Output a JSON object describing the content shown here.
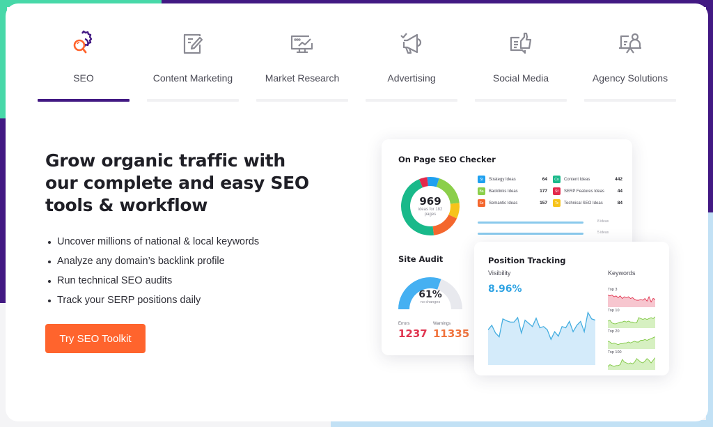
{
  "tabs": [
    {
      "label": "SEO",
      "icon": "seo-gear-magnifier-icon",
      "active": true
    },
    {
      "label": "Content Marketing",
      "icon": "document-edit-icon",
      "active": false
    },
    {
      "label": "Market Research",
      "icon": "monitor-chart-icon",
      "active": false
    },
    {
      "label": "Advertising",
      "icon": "megaphone-icon",
      "active": false
    },
    {
      "label": "Social Media",
      "icon": "thumbs-up-chat-icon",
      "active": false
    },
    {
      "label": "Agency Solutions",
      "icon": "presenter-board-icon",
      "active": false
    }
  ],
  "hero": {
    "headline": "Grow organic traffic with our complete and easy SEO tools & workflow",
    "bullets": [
      "Uncover millions of national & local keywords",
      "Analyze any domain’s backlink profile",
      "Run technical SEO audits",
      "Track your SERP positions daily"
    ],
    "cta_label": "Try SEO Toolkit"
  },
  "colors": {
    "brand_purple": "#421983",
    "cta_orange": "#ff642d",
    "accent_blue": "#2fa3e3",
    "errors_red": "#e0344f",
    "warnings_orange": "#f0733c"
  },
  "on_page_checker": {
    "title": "On Page SEO Checker",
    "total": "969",
    "total_sub": "ideas for 182 pages",
    "ideas": [
      {
        "abbr": "St",
        "label": "Strategy Ideas",
        "value": 64,
        "color": "#1ea0f0"
      },
      {
        "abbr": "Co",
        "label": "Content Ideas",
        "value": 442,
        "color": "#19b98a"
      },
      {
        "abbr": "Ba",
        "label": "Backlinks Ideas",
        "value": 177,
        "color": "#8bcf4a"
      },
      {
        "abbr": "Sf",
        "label": "SERP Features Ideas",
        "value": 44,
        "color": "#e3284b"
      },
      {
        "abbr": "Se",
        "label": "Semantic Ideas",
        "value": 157,
        "color": "#f4672e"
      },
      {
        "abbr": "Te",
        "label": "Technical SEO Ideas",
        "value": 84,
        "color": "#f7c31a"
      }
    ],
    "donut_order": [
      "SERP Features Ideas",
      "Strategy Ideas",
      "Backlinks Ideas",
      "Technical SEO Ideas",
      "Semantic Ideas",
      "Content Ideas"
    ],
    "bars": [
      {
        "label": "8 ideas"
      },
      {
        "label": "5 ideas"
      }
    ]
  },
  "site_audit": {
    "title": "Site Audit",
    "percent": 61,
    "percent_label": "61%",
    "sub": "no changes",
    "errors_label": "Errors",
    "errors_value": "1237",
    "warnings_label": "Warnings",
    "warnings_value": "11335"
  },
  "position_tracking": {
    "title": "Position Tracking",
    "visibility_label": "Visibility",
    "visibility_value": "8.96%",
    "visibility_series": [
      55,
      62,
      50,
      44,
      72,
      69,
      67,
      67,
      74,
      50,
      70,
      65,
      60,
      73,
      58,
      60,
      55,
      40,
      52,
      45,
      60,
      58,
      68,
      52,
      62,
      68,
      52,
      82,
      72,
      70
    ],
    "keywords_label": "Keywords",
    "keywords": [
      {
        "label": "Top 3",
        "color": "#e0344f",
        "fill": "#f7c6cf",
        "series": [
          14,
          13,
          14,
          12,
          13,
          11,
          13,
          10,
          12,
          11,
          12,
          10,
          11,
          9,
          8,
          8,
          9,
          8,
          10,
          7,
          12,
          6,
          10,
          9
        ]
      },
      {
        "label": "Top 10",
        "color": "#7fc742",
        "fill": "#d6f0c1",
        "series": [
          8,
          9,
          6,
          5,
          5,
          6,
          7,
          7,
          8,
          7,
          8,
          7,
          7,
          6,
          6,
          12,
          11,
          10,
          11,
          10,
          11,
          12,
          11,
          13
        ]
      },
      {
        "label": "Top 20",
        "color": "#7fc742",
        "fill": "#d6f0c1",
        "series": [
          9,
          8,
          6,
          7,
          6,
          5,
          6,
          6,
          7,
          7,
          8,
          7,
          8,
          9,
          8,
          8,
          10,
          10,
          11,
          10,
          11,
          12,
          13,
          14
        ]
      },
      {
        "label": "Top 100",
        "color": "#7fc742",
        "fill": "#d6f0c1",
        "series": [
          4,
          6,
          5,
          4,
          5,
          5,
          6,
          12,
          9,
          8,
          7,
          8,
          7,
          9,
          13,
          11,
          9,
          8,
          10,
          13,
          11,
          8,
          11,
          14
        ]
      }
    ]
  }
}
